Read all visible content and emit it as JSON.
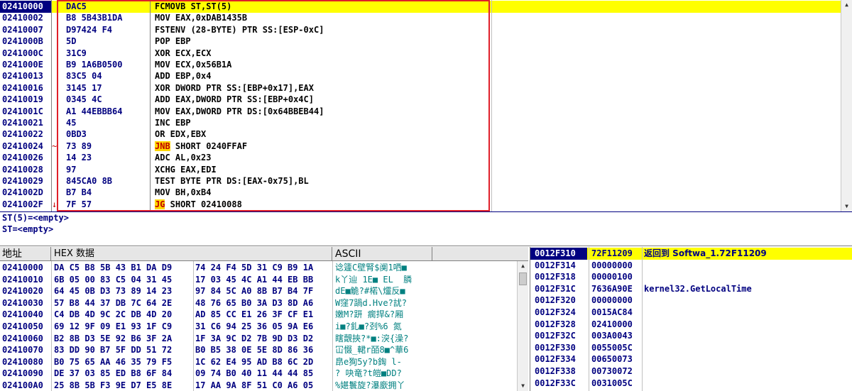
{
  "disasm": {
    "rows": [
      {
        "addr": "02410000",
        "jmark": "",
        "hex": "DAC5",
        "mn": "",
        "ops": "FCMOVB ST,ST(5)"
      },
      {
        "addr": "02410002",
        "jmark": "",
        "hex": "B8 5B43B1DA",
        "mn": "",
        "ops": "MOV EAX,0xDAB1435B"
      },
      {
        "addr": "02410007",
        "jmark": "",
        "hex": "D97424 F4",
        "mn": "",
        "ops": "FSTENV (28-BYTE) PTR SS:[ESP-0xC]"
      },
      {
        "addr": "0241000B",
        "jmark": "",
        "hex": "5D",
        "mn": "",
        "ops": "POP EBP"
      },
      {
        "addr": "0241000C",
        "jmark": "",
        "hex": "31C9",
        "mn": "",
        "ops": "XOR ECX,ECX"
      },
      {
        "addr": "0241000E",
        "jmark": "",
        "hex": "B9 1A6B0500",
        "mn": "",
        "ops": "MOV ECX,0x56B1A"
      },
      {
        "addr": "02410013",
        "jmark": "",
        "hex": "83C5 04",
        "mn": "",
        "ops": "ADD EBP,0x4"
      },
      {
        "addr": "02410016",
        "jmark": "",
        "hex": "3145 17",
        "mn": "",
        "ops": "XOR DWORD PTR SS:[EBP+0x17],EAX"
      },
      {
        "addr": "02410019",
        "jmark": "",
        "hex": "0345 4C",
        "mn": "",
        "ops": "ADD EAX,DWORD PTR SS:[EBP+0x4C]"
      },
      {
        "addr": "0241001C",
        "jmark": "",
        "hex": "A1 44EBBB64",
        "mn": "",
        "ops": "MOV EAX,DWORD PTR DS:[0x64BBEB44]"
      },
      {
        "addr": "02410021",
        "jmark": "",
        "hex": "45",
        "mn": "",
        "ops": "INC EBP"
      },
      {
        "addr": "02410022",
        "jmark": "",
        "hex": "0BD3",
        "mn": "",
        "ops": "OR EDX,EBX"
      },
      {
        "addr": "02410024",
        "jmark": "~",
        "hex": "73 89",
        "mn": "JNB",
        "ops": " SHORT 0240FFAF"
      },
      {
        "addr": "02410026",
        "jmark": "",
        "hex": "14 23",
        "mn": "",
        "ops": "ADC AL,0x23"
      },
      {
        "addr": "02410028",
        "jmark": "",
        "hex": "97",
        "mn": "",
        "ops": "XCHG EAX,EDI"
      },
      {
        "addr": "02410029",
        "jmark": "",
        "hex": "845CA0 8B",
        "mn": "",
        "ops": "TEST BYTE PTR DS:[EAX-0x75],BL"
      },
      {
        "addr": "0241002D",
        "jmark": "",
        "hex": "B7 B4",
        "mn": "",
        "ops": "MOV BH,0xB4"
      },
      {
        "addr": "0241002F",
        "jmark": "↓",
        "hex": "7F 57",
        "mn": "JG",
        "ops": " SHORT 02410088"
      }
    ]
  },
  "info": {
    "line1": "ST(5)=<empty>",
    "line2": "ST=<empty>"
  },
  "dump": {
    "header_addr": "地址",
    "header_hex": "HEX 数据",
    "header_ascii": "ASCII",
    "rows": [
      {
        "addr": "02410000",
        "h1": "DA C5 B8 5B 43 B1 DA D9",
        "h2": "74 24 F4 5D 31 C9 B9 1A",
        "ascii": "谂籧C壁腎$阒1哂■"
      },
      {
        "addr": "02410010",
        "h1": "6B 05 00 83 C5 04 31 45",
        "h2": "17 03 45 4C A1 44 EB BB",
        "ascii": "k丫辿 1E■ EL  膦"
      },
      {
        "addr": "02410020",
        "h1": "64 45 0B D3 73 89 14 23",
        "h2": "97 84 5C A0 8B B7 B4 7F",
        "ascii": "dE■觤?#楉\\爧反■"
      },
      {
        "addr": "02410030",
        "h1": "57 B8 44 37 DB 7C 64 2E",
        "h2": "48 76 65 B0 3A D3 8D A6",
        "ascii": "W窪7踻d.Hve?訧?"
      },
      {
        "addr": "02410040",
        "h1": "C4 DB 4D 9C 2C DB 4D 20",
        "h2": "AD 85 CC E1 26 3F CF E1",
        "ascii": "嫩M?趼 瘸捍&?厢"
      },
      {
        "addr": "02410050",
        "h1": "69 12 9F 09 E1 93 1F C9",
        "h2": "31 C6 94 25 36 05 9A E6",
        "ascii": "i■?釓■?刭%6 氮"
      },
      {
        "addr": "02410060",
        "h1": "B2 8B D3 5E 92 B6 3F 2A",
        "h2": "1F 3A 9C D2 7B 9D D3 D2",
        "ascii": "瞎覿挾?*■:湥{澡?"
      },
      {
        "addr": "02410070",
        "h1": "83 DD 90 B7 5F DD 51 72",
        "h2": "B0 B5 38 0E 5E 8D 86 36",
        "ascii": "冚惙_輑r皕8■^華6"
      },
      {
        "addr": "02410080",
        "h1": "B0 75 65 AA 46 35 79 F5",
        "h2": "1C 62 E4 95 AD B8 6C 2D",
        "ascii": "皍e狥5y?b鋾 l-"
      },
      {
        "addr": "02410090",
        "h1": "DE 37 03 85 ED B8 6F 84",
        "h2": "09 74 B0 40 11 44 44 85",
        "ascii": "? 吷竜?t皚■DD?"
      },
      {
        "addr": "024100A0",
        "h1": "25 8B 5B F3 9E D7 E5 8E",
        "h2": "17 AA 9A 8F 51 C0 A6 05",
        "ascii": "%媅鬟旋?瀑廞拥丫"
      }
    ]
  },
  "stack": {
    "rows": [
      {
        "addr": "0012F310",
        "val": "72F11209",
        "comment": "返回到 Softwa_1.72F11209"
      },
      {
        "addr": "0012F314",
        "val": "00000000",
        "comment": ""
      },
      {
        "addr": "0012F318",
        "val": "00000100",
        "comment": ""
      },
      {
        "addr": "0012F31C",
        "val": "7636A90E",
        "comment": "kernel32.GetLocalTime"
      },
      {
        "addr": "0012F320",
        "val": "00000000",
        "comment": ""
      },
      {
        "addr": "0012F324",
        "val": "0015AC84",
        "comment": ""
      },
      {
        "addr": "0012F328",
        "val": "02410000",
        "comment": ""
      },
      {
        "addr": "0012F32C",
        "val": "003A0043",
        "comment": ""
      },
      {
        "addr": "0012F330",
        "val": "0055005C",
        "comment": ""
      },
      {
        "addr": "0012F334",
        "val": "00650073",
        "comment": ""
      },
      {
        "addr": "0012F338",
        "val": "00730072",
        "comment": ""
      },
      {
        "addr": "0012F33C",
        "val": "0031005C",
        "comment": ""
      }
    ]
  },
  "icons": {
    "scroll_up": "scroll-up-arrow-icon",
    "scroll_down": "scroll-down-arrow-icon"
  },
  "colors": {
    "selection": "#ffff00",
    "address_bg": "#000080",
    "highlight_box": "#e0202a",
    "jump_mnemonic_bg": "#ffd700"
  }
}
